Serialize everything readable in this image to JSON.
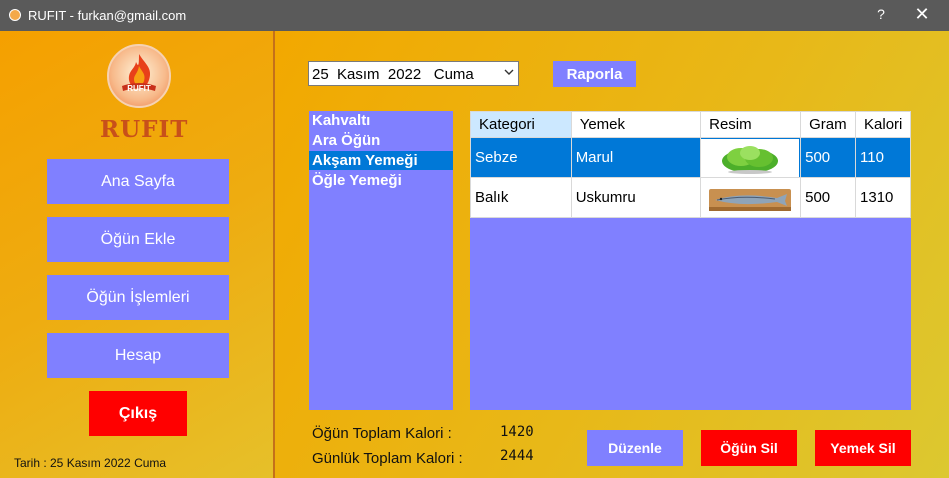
{
  "window": {
    "title": "RUFIT - furkan@gmail.com",
    "help_label": "?",
    "close_label": "✕"
  },
  "sidebar": {
    "logo_text": "RUFIT",
    "logo_badge": "RUFIT",
    "buttons": [
      "Ana Sayfa",
      "Öğün Ekle",
      "Öğün İşlemleri",
      "Hesap"
    ],
    "exit_label": "Çıkış",
    "date_label": "Tarih : 25 Kasım 2022 Cuma"
  },
  "toolbar": {
    "date_value": "25  Kasım  2022   Cuma",
    "report_label": "Raporla"
  },
  "meals": {
    "items": [
      "Kahvaltı",
      "Ara Öğün",
      "Akşam Yemeği",
      "Öğle Yemeği"
    ],
    "selected": "Akşam Yemeği"
  },
  "grid": {
    "columns": [
      "Kategori",
      "Yemek",
      "Resim",
      "Gram",
      "Kalori"
    ],
    "rows": [
      {
        "kategori": "Sebze",
        "yemek": "Marul",
        "resim": "lettuce-image",
        "gram": "500",
        "kalori": "110"
      },
      {
        "kategori": "Balık",
        "yemek": "Uskumru",
        "resim": "mackerel-image",
        "gram": "500",
        "kalori": "1310"
      }
    ]
  },
  "summary": {
    "meal_total_label": "Öğün Toplam Kalori :",
    "meal_total_value": "1420",
    "daily_total_label": "Günlük Toplam Kalori :",
    "daily_total_value": "2444"
  },
  "actions": {
    "edit_label": "Düzenle",
    "delete_meal_label": "Öğün Sil",
    "delete_food_label": "Yemek Sil"
  },
  "colors": {
    "button": "#8080ff",
    "danger": "#ff0000",
    "selection": "#0078d7",
    "accent_text": "#c8501a"
  }
}
